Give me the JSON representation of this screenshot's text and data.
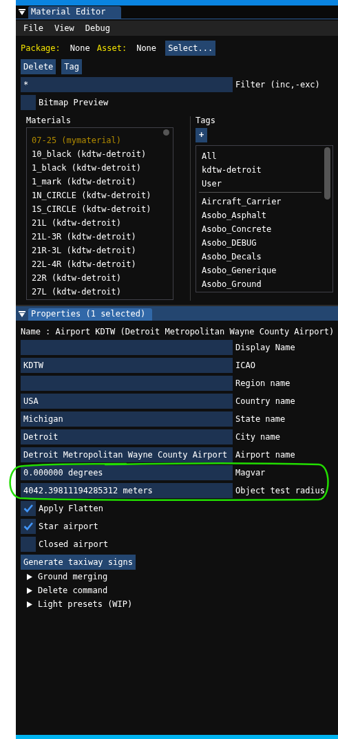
{
  "editor": {
    "title": "Material Editor",
    "menu": [
      "File",
      "View",
      "Debug"
    ],
    "package_label": "Package:",
    "package_value": "None",
    "asset_label": "Asset:",
    "asset_value": "None",
    "select_button": "Select...",
    "actions": [
      "Delete",
      "Tag"
    ],
    "filter": {
      "value": "*",
      "label": "Filter (inc,-exc)"
    },
    "bitmap_preview": {
      "label": "Bitmap Preview",
      "checked": false
    },
    "materials": {
      "heading": "Materials",
      "items": [
        {
          "label": "07-25 (mymaterial)",
          "selected": true
        },
        {
          "label": "10_black (kdtw-detroit)",
          "selected": false
        },
        {
          "label": "1_black (kdtw-detroit)",
          "selected": false
        },
        {
          "label": "1_mark (kdtw-detroit)",
          "selected": false
        },
        {
          "label": "1N_CIRCLE (kdtw-detroit)",
          "selected": false
        },
        {
          "label": "1S_CIRCLE (kdtw-detroit)",
          "selected": false
        },
        {
          "label": "21L (kdtw-detroit)",
          "selected": false
        },
        {
          "label": "21L-3R (kdtw-detroit)",
          "selected": false
        },
        {
          "label": "21R-3L (kdtw-detroit)",
          "selected": false
        },
        {
          "label": "22L-4R (kdtw-detroit)",
          "selected": false
        },
        {
          "label": "22R (kdtw-detroit)",
          "selected": false
        },
        {
          "label": "27L (kdtw-detroit)",
          "selected": false
        }
      ]
    },
    "tags": {
      "heading": "Tags",
      "add_button": "+",
      "fixed": [
        "All",
        "kdtw-detroit",
        "User"
      ],
      "items": [
        "Aircraft_Carrier",
        "Asobo_Asphalt",
        "Asobo_Concrete",
        "Asobo_DEBUG",
        "Asobo_Decals",
        "Asobo_Generique",
        "Asobo_Ground"
      ]
    }
  },
  "properties": {
    "title": "Properties (1 selected)",
    "name_line": "Name : Airport KDTW (Detroit Metropolitan Wayne County Airport)",
    "fields": [
      {
        "label": "Display Name"
      },
      {
        "value": "KDTW",
        "label": "ICAO"
      },
      {
        "label": "Region name"
      },
      {
        "value": "USA",
        "label": "Country name"
      },
      {
        "value": "Michigan",
        "label": "State name"
      },
      {
        "value": "Detroit",
        "label": "City name"
      },
      {
        "value": "Detroit Metropolitan Wayne County Airport",
        "label": "Airport name"
      },
      {
        "value": "0.000000 degrees",
        "label": "Magvar"
      },
      {
        "value": "4042.39811194285312 meters",
        "label": "Object test radius"
      }
    ],
    "checkboxes": [
      {
        "label": "Apply Flatten",
        "checked": true
      },
      {
        "label": "Star airport",
        "checked": true
      },
      {
        "label": "Closed airport",
        "checked": false
      }
    ],
    "generate_button": "Generate taxiway signs",
    "sections": [
      {
        "label": "Ground merging",
        "expanded": false
      },
      {
        "label": "Delete command",
        "expanded": false
      },
      {
        "label": "Light presets (WIP)",
        "expanded": false
      }
    ]
  }
}
